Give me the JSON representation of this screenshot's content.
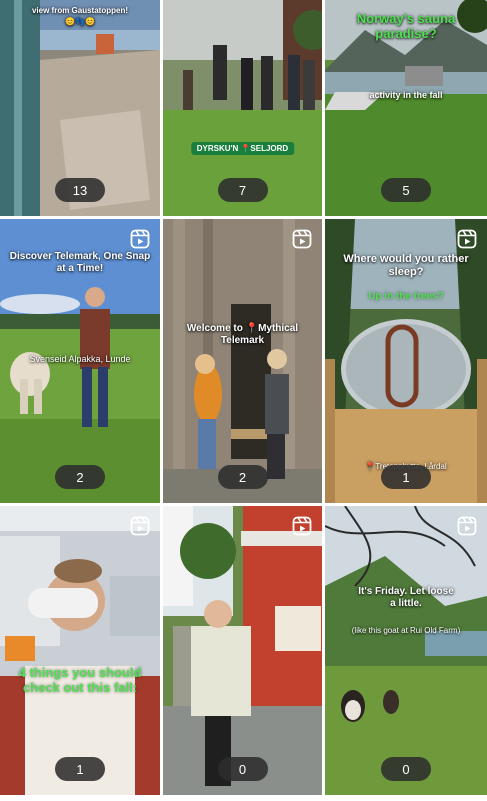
{
  "tiles": [
    {
      "caption": "view from Gaustatoppen!",
      "emojis": "😊👣😊",
      "count": "13"
    },
    {
      "caption": "DYRSKU'N 📍SELJORD",
      "count": "7"
    },
    {
      "caption": "Norway's sauna paradise?",
      "caption2": "activity in the fall",
      "count": "5"
    },
    {
      "caption": "Discover Telemark, One Snap at a Time!",
      "caption2": "Svenseid Alpakka, Lunde",
      "count": "2",
      "reels": "reels-icon"
    },
    {
      "caption": "Welcome to 📍Mythical Telemark",
      "count": "2",
      "reels": "reels-icon"
    },
    {
      "caption": "Where would you rather sleep?",
      "caption2": "Up in the trees?",
      "caption3": "📍Tretopphytte, Lårdal",
      "count": "1",
      "reels": "reels-icon"
    },
    {
      "caption": "4 things you should check out this fall:",
      "count": "1",
      "reels": "reels-icon"
    },
    {
      "caption": "",
      "count": "0",
      "reels": "reels-icon"
    },
    {
      "caption": "It's Friday. Let loose a little.",
      "caption2": "(like this goat at Rui Old Farm)",
      "count": "0",
      "reels": "reels-icon"
    }
  ],
  "colors": {
    "pill": "#2d2d2d",
    "accent_green": "#4fe04f"
  }
}
